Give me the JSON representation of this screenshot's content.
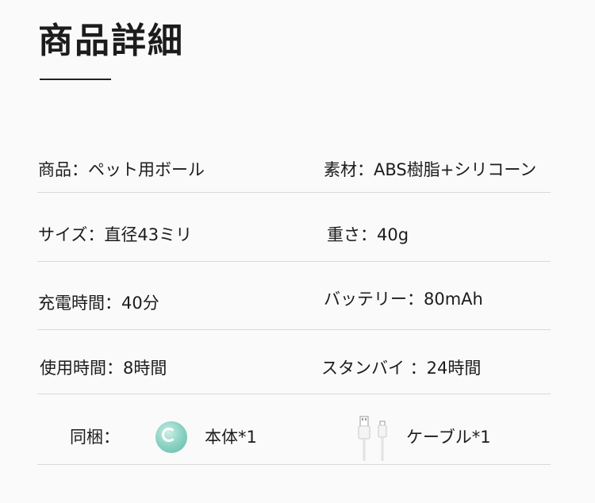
{
  "page": {
    "title": "商品詳細"
  },
  "specs": {
    "product": "商品：ペット用ボール",
    "material": "素材：ABS樹脂+シリコーン",
    "size": "サイズ：直径43ミリ",
    "weight": "重さ：40g",
    "charge_time": "充電時間：40分",
    "battery": "バッテリー：80mAh",
    "use_time": "使用時間：8時間",
    "standby": "スタンバイ ：24時間"
  },
  "included": {
    "label": "同梱：",
    "item1": "本体*1",
    "item2": "ケーブル*1",
    "item1_icon": "ball-icon",
    "item2_icon": "usb-cable-icon"
  },
  "colors": {
    "text": "#1c1c1c",
    "divider": "#d9d9d9",
    "ball": "#8fd5c6"
  }
}
